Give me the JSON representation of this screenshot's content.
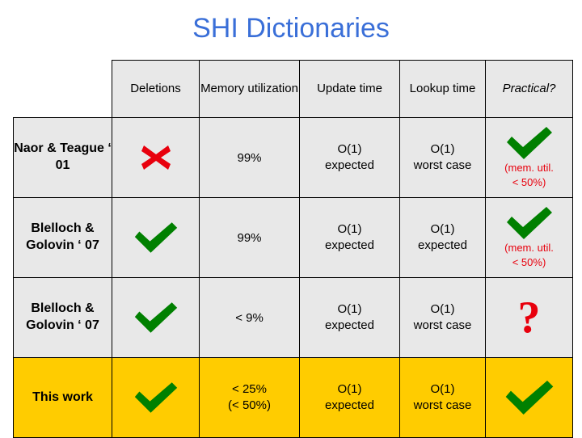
{
  "title": "SHI Dictionaries",
  "table": {
    "headers": {
      "corner": "",
      "deletions": "Deletions",
      "memory": "Memory utilization",
      "update": "Update time",
      "lookup": "Lookup time",
      "practical": "Practical?"
    },
    "rows": [
      {
        "label": "Naor & Teague ‘ 01",
        "deletions_icon": "cross-icon",
        "memory": "99%",
        "update_line1": "O(1)",
        "update_line2": "expected",
        "lookup_line1": "O(1)",
        "lookup_line2": "worst case",
        "practical_icon": "check-icon",
        "practical_note_line1": "(mem. util.",
        "practical_note_line2": "< 50%)",
        "highlight": false
      },
      {
        "label": "Blelloch & Golovin ‘ 07",
        "deletions_icon": "check-icon",
        "memory": "99%",
        "update_line1": "O(1)",
        "update_line2": "expected",
        "lookup_line1": "O(1)",
        "lookup_line2": "expected",
        "practical_icon": "check-icon",
        "practical_note_line1": "(mem. util.",
        "practical_note_line2": "< 50%)",
        "highlight": false
      },
      {
        "label": "Blelloch & Golovin ‘ 07",
        "deletions_icon": "check-icon",
        "memory": "< 9%",
        "update_line1": "O(1)",
        "update_line2": "expected",
        "lookup_line1": "O(1)",
        "lookup_line2": "worst case",
        "practical_icon": "question-mark",
        "practical_note_line1": "",
        "practical_note_line2": "",
        "highlight": false
      },
      {
        "label": "This work",
        "deletions_icon": "check-icon",
        "memory_line1": "< 25%",
        "memory_line2": "(< 50%)",
        "update_line1": "O(1)",
        "update_line2": "expected",
        "lookup_line1": "O(1)",
        "lookup_line2": "worst case",
        "practical_icon": "check-icon",
        "practical_note_line1": "",
        "practical_note_line2": "",
        "highlight": true
      }
    ]
  },
  "colors": {
    "title": "#3a6fd8",
    "header_bg": "#e8e8e8",
    "highlight_bg": "#ffcc00",
    "red": "#e8000d",
    "green": "#008000"
  }
}
